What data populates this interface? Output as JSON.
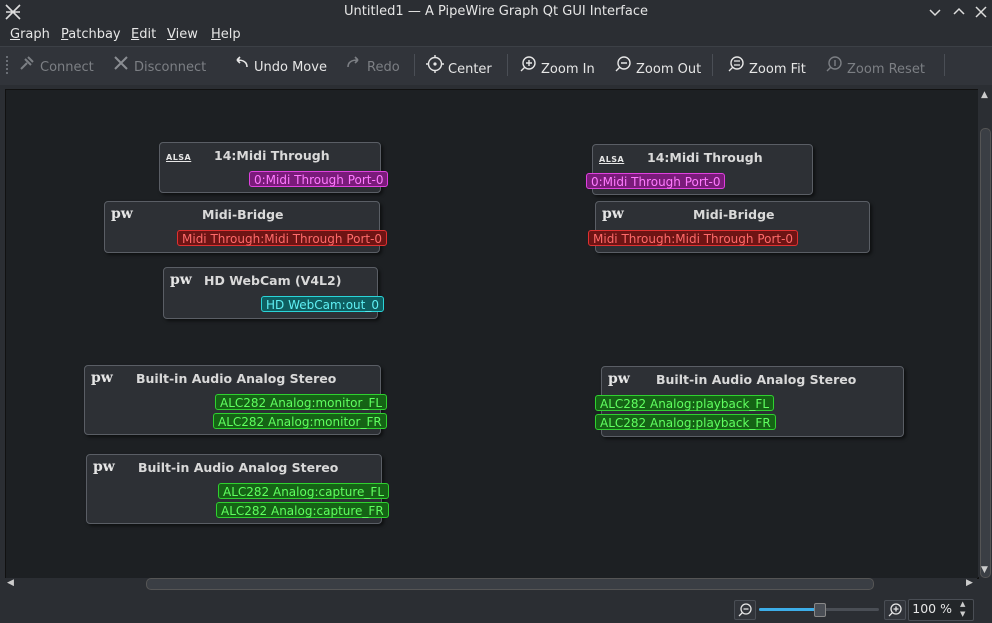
{
  "window": {
    "title": "Untitled1 — A PipeWire Graph Qt GUI Interface",
    "icon": "pipewire-logo-icon",
    "controls": [
      "minimize",
      "maximize",
      "close"
    ]
  },
  "menubar": {
    "items": [
      {
        "label": "Graph"
      },
      {
        "label": "Patchbay"
      },
      {
        "label": "Edit"
      },
      {
        "label": "View"
      },
      {
        "label": "Help"
      }
    ]
  },
  "toolbar": {
    "connect": {
      "label": "Connect",
      "icon": "connect-icon",
      "enabled": false
    },
    "disconnect": {
      "label": "Disconnect",
      "icon": "disconnect-icon",
      "enabled": false
    },
    "undo": {
      "label": "Undo Move",
      "icon": "undo-icon",
      "enabled": true
    },
    "redo": {
      "label": "Redo",
      "icon": "redo-icon",
      "enabled": false
    },
    "center": {
      "label": "Center",
      "icon": "center-icon",
      "enabled": true
    },
    "zoom_in": {
      "label": "Zoom In",
      "icon": "zoom-in-icon",
      "enabled": true
    },
    "zoom_out": {
      "label": "Zoom Out",
      "icon": "zoom-out-icon",
      "enabled": true
    },
    "zoom_fit": {
      "label": "Zoom Fit",
      "icon": "zoom-fit-icon",
      "enabled": true
    },
    "zoom_reset": {
      "label": "Zoom Reset",
      "icon": "zoom-reset-icon",
      "enabled": false
    }
  },
  "nodes": {
    "midi_through_out": {
      "icon": "ALSA",
      "title": "14:Midi Through",
      "ports": [
        "0:Midi Through Port-0"
      ]
    },
    "midi_bridge_out": {
      "icon": "pw",
      "title": "Midi-Bridge",
      "ports": [
        "Midi Through:Midi Through Port-0"
      ]
    },
    "webcam": {
      "icon": "pw",
      "title": "HD WebCam (V4L2)",
      "ports": [
        "HD WebCam:out_0"
      ]
    },
    "audio_monitor": {
      "icon": "pw",
      "title": "Built-in Audio Analog Stereo",
      "ports": [
        "ALC282 Analog:monitor_FL",
        "ALC282 Analog:monitor_FR"
      ]
    },
    "audio_capture": {
      "icon": "pw",
      "title": "Built-in Audio Analog Stereo",
      "ports": [
        "ALC282 Analog:capture_FL",
        "ALC282 Analog:capture_FR"
      ]
    },
    "midi_through_in": {
      "icon": "ALSA",
      "title": "14:Midi Through",
      "ports": [
        "0:Midi Through Port-0"
      ]
    },
    "midi_bridge_in": {
      "icon": "pw",
      "title": "Midi-Bridge",
      "ports": [
        "Midi Through:Midi Through Port-0"
      ]
    },
    "audio_playback": {
      "icon": "pw",
      "title": "Built-in Audio Analog Stereo",
      "ports": [
        "ALC282 Analog:playback_FL",
        "ALC282 Analog:playback_FR"
      ]
    }
  },
  "port_colors": {
    "midi": "#e040e0",
    "midi_bridge": "#e03030",
    "video": "#2ad4d8",
    "audio": "#2fd12f"
  },
  "statusbar": {
    "zoom_value": "100 %",
    "zoom_slider_fraction": 0.5
  }
}
